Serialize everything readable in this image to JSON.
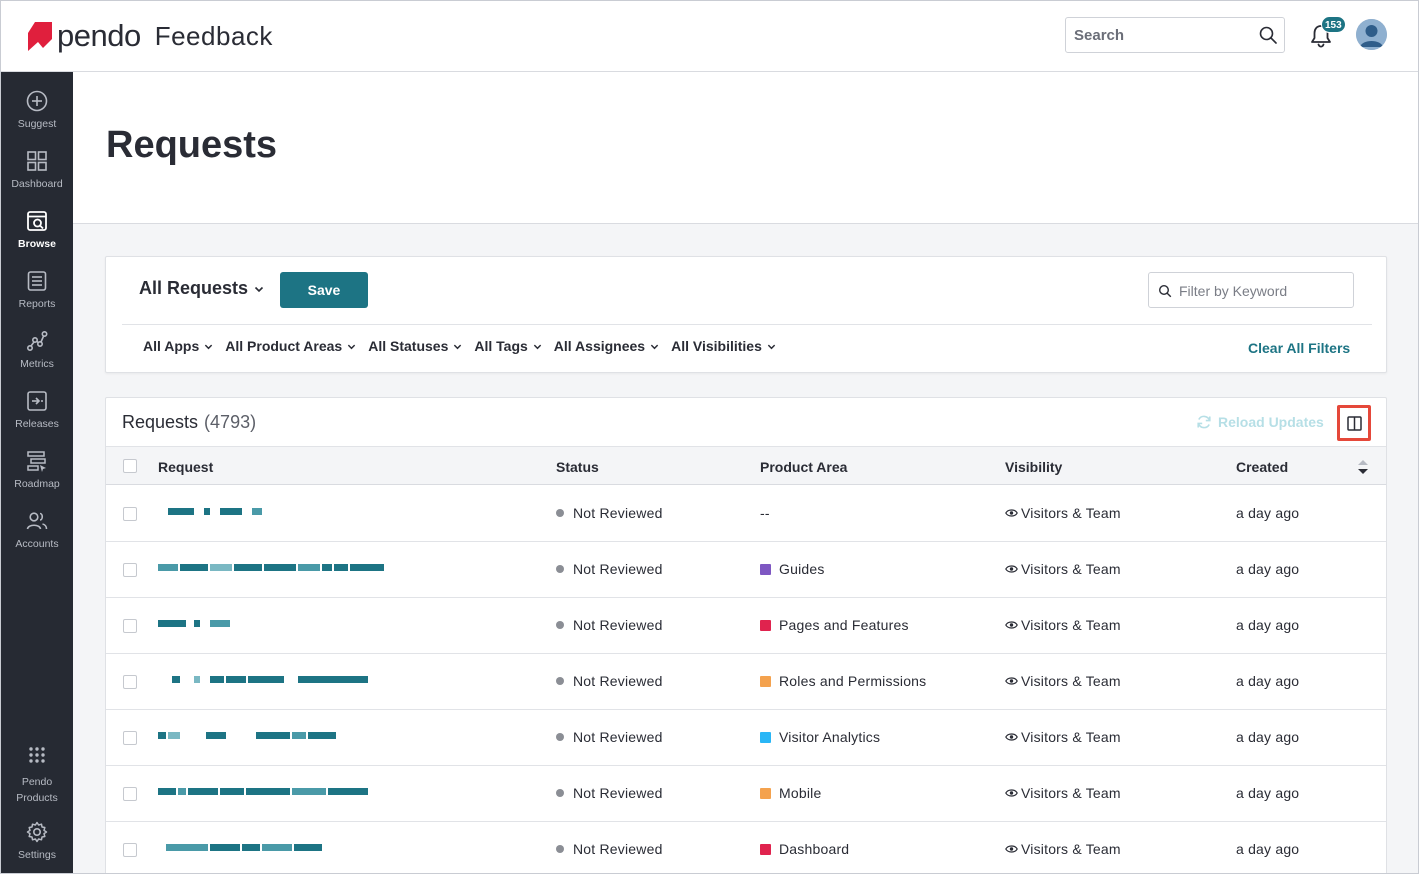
{
  "app": {
    "logo_text": "pendo",
    "product_name": "Feedback",
    "brand_color": "#e01f3d",
    "accent_color": "#1d7484"
  },
  "topbar": {
    "search_placeholder": "Search",
    "notification_count": "153"
  },
  "sidebar": {
    "items": [
      {
        "label": "Suggest",
        "icon": "plus-circle-icon"
      },
      {
        "label": "Dashboard",
        "icon": "grid-icon"
      },
      {
        "label": "Browse",
        "icon": "browse-icon",
        "active": true
      },
      {
        "label": "Reports",
        "icon": "report-icon"
      },
      {
        "label": "Metrics",
        "icon": "metrics-icon"
      },
      {
        "label": "Releases",
        "icon": "releases-icon"
      },
      {
        "label": "Roadmap",
        "icon": "roadmap-icon"
      },
      {
        "label": "Accounts",
        "icon": "accounts-icon"
      }
    ],
    "bottom_items": [
      {
        "label": "Pendo Products",
        "line1": "Pendo",
        "line2": "Products",
        "icon": "dots-grid-icon"
      },
      {
        "label": "Settings",
        "icon": "gear-icon"
      }
    ]
  },
  "page": {
    "title": "Requests"
  },
  "filters": {
    "view_label": "All Requests",
    "save_label": "Save",
    "keyword_placeholder": "Filter by Keyword",
    "dropdowns": [
      "All Apps",
      "All Product Areas",
      "All Statuses",
      "All Tags",
      "All Assignees",
      "All Visibilities"
    ],
    "clear_label": "Clear All Filters"
  },
  "table": {
    "title": "Requests",
    "count": "(4793)",
    "reload_label": "Reload Updates",
    "columns": [
      "Request",
      "Status",
      "Product Area",
      "Visibility",
      "Created"
    ],
    "rows": [
      {
        "request": "[redacted]",
        "status": "Not Reviewed",
        "product_area": "--",
        "area_color": "",
        "visibility": "Visitors & Team",
        "created": "a day ago"
      },
      {
        "request": "[redacted]",
        "status": "Not Reviewed",
        "product_area": "Guides",
        "area_color": "#7e57c2",
        "visibility": "Visitors & Team",
        "created": "a day ago"
      },
      {
        "request": "[redacted]",
        "status": "Not Reviewed",
        "product_area": "Pages and Features",
        "area_color": "#e0234e",
        "visibility": "Visitors & Team",
        "created": "a day ago"
      },
      {
        "request": "[redacted]",
        "status": "Not Reviewed",
        "product_area": "Roles and Permissions",
        "area_color": "#f4a24e",
        "visibility": "Visitors & Team",
        "created": "a day ago"
      },
      {
        "request": "[redacted]",
        "status": "Not Reviewed",
        "product_area": "Visitor Analytics",
        "area_color": "#29b6f6",
        "visibility": "Visitors & Team",
        "created": "a day ago"
      },
      {
        "request": "[redacted]",
        "status": "Not Reviewed",
        "product_area": "Mobile",
        "area_color": "#f4a24e",
        "visibility": "Visitors & Team",
        "created": "a day ago"
      },
      {
        "request": "[redacted]",
        "status": "Not Reviewed",
        "product_area": "Dashboard",
        "area_color": "#e0234e",
        "visibility": "Visitors & Team",
        "created": "a day ago"
      }
    ]
  }
}
